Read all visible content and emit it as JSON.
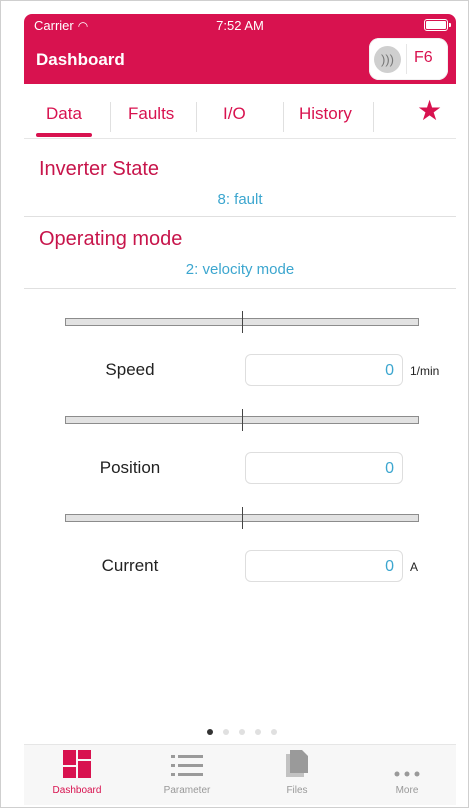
{
  "status_bar": {
    "carrier": "Carrier",
    "time": "7:52 AM"
  },
  "header": {
    "title": "Dashboard",
    "device_badge": "F6"
  },
  "tabs": [
    {
      "label": "Data",
      "selected": true
    },
    {
      "label": "Faults",
      "selected": false
    },
    {
      "label": "I/O",
      "selected": false
    },
    {
      "label": "History",
      "selected": false
    }
  ],
  "favorites_icon": "star-icon",
  "inverter_state": {
    "label": "Inverter State",
    "value": "8: fault"
  },
  "operating_mode": {
    "label": "Operating mode",
    "value": "2: velocity mode"
  },
  "measurements": [
    {
      "label": "Speed",
      "value": "0",
      "unit": "1/min"
    },
    {
      "label": "Position",
      "value": "0",
      "unit": ""
    },
    {
      "label": "Current",
      "value": "0",
      "unit": "A"
    }
  ],
  "page_indicator": {
    "count": 5,
    "active": 0
  },
  "tab_bar": [
    {
      "label": "Dashboard",
      "icon": "dashboard-icon",
      "active": true
    },
    {
      "label": "Parameter",
      "icon": "list-icon",
      "active": false
    },
    {
      "label": "Files",
      "icon": "files-icon",
      "active": false
    },
    {
      "label": "More",
      "icon": "more-icon",
      "active": false
    }
  ],
  "colors": {
    "accent": "#d8124f",
    "value": "#3ca6cf"
  }
}
